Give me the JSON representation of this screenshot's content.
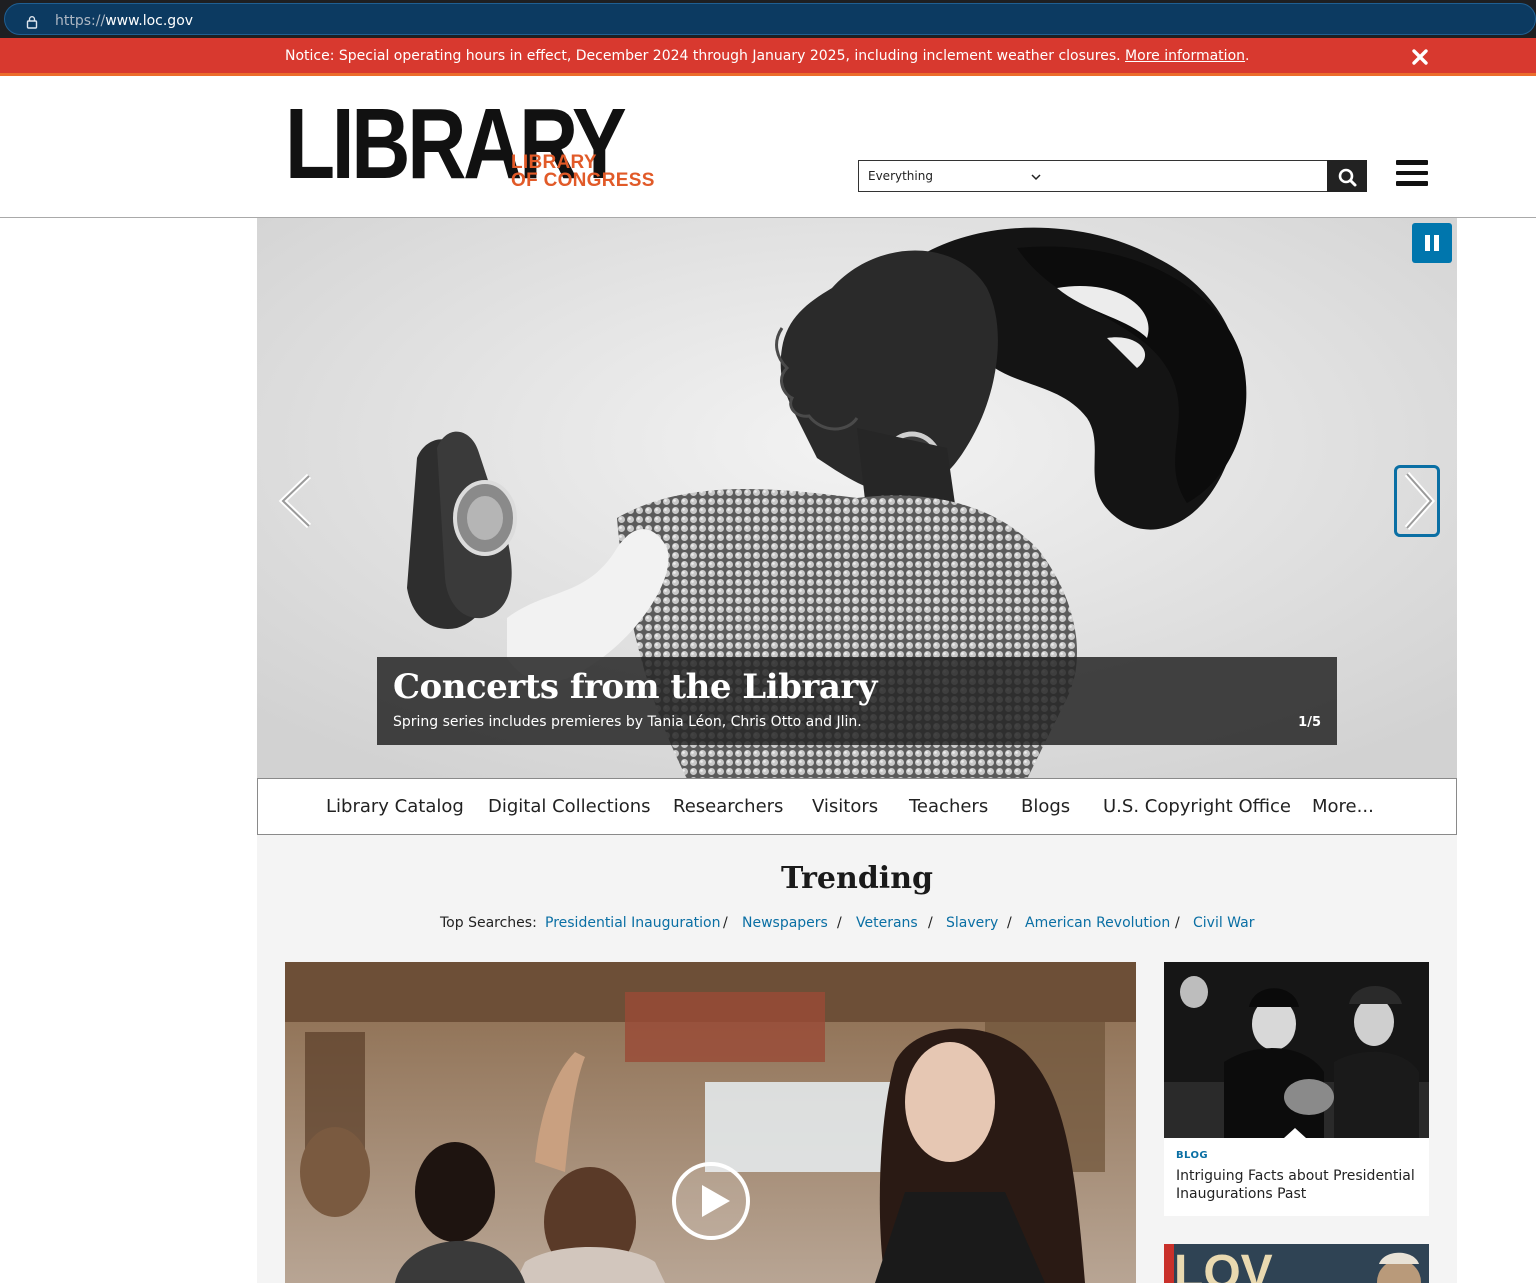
{
  "browser": {
    "url_protocol": "https://",
    "url_host": "www.loc.gov"
  },
  "notice": {
    "text": "Notice: Special operating hours in effect, December 2024 through January 2025, including inclement weather closures.",
    "link_label": "More information",
    "trailing": "."
  },
  "header": {
    "logo_big": "LIBRARY",
    "logo_small_line1": "LIBRARY",
    "logo_small_line2": "OF CONGRESS",
    "search_scope": "Everything",
    "search_value": ""
  },
  "hero": {
    "title": "Concerts from the Library",
    "subtitle": "Spring series includes premieres by Tania Léon, Chris Otto and Jlin.",
    "counter": "1/5"
  },
  "nav": {
    "items": [
      {
        "label": "Library Catalog"
      },
      {
        "label": "Digital Collections"
      },
      {
        "label": "Researchers"
      },
      {
        "label": "Visitors"
      },
      {
        "label": "Teachers"
      },
      {
        "label": "Blogs"
      },
      {
        "label": "U.S. Copyright Office"
      },
      {
        "label": "More..."
      }
    ]
  },
  "trending": {
    "title": "Trending",
    "top_searches_label": "Top Searches:",
    "searches": [
      {
        "label": "Presidential Inauguration"
      },
      {
        "label": "Newspapers"
      },
      {
        "label": "Veterans"
      },
      {
        "label": "Slavery"
      },
      {
        "label": "American Revolution"
      },
      {
        "label": "Civil War"
      }
    ],
    "separator": "/",
    "card": {
      "tag": "BLOG",
      "title": "Intriguing Facts about Presidential Inaugurations Past"
    },
    "card2_text": "LOV"
  },
  "colors": {
    "notice_red": "#d8392f",
    "brand_orange": "#e15a28",
    "link_blue": "#0a6fa4",
    "address_bar_blue": "#0c3a61"
  },
  "icons": [
    "lock-icon",
    "close-icon",
    "chevron-down-icon",
    "search-icon",
    "hamburger-menu-icon",
    "pause-icon",
    "chevron-left-icon",
    "chevron-right-icon",
    "play-icon"
  ]
}
